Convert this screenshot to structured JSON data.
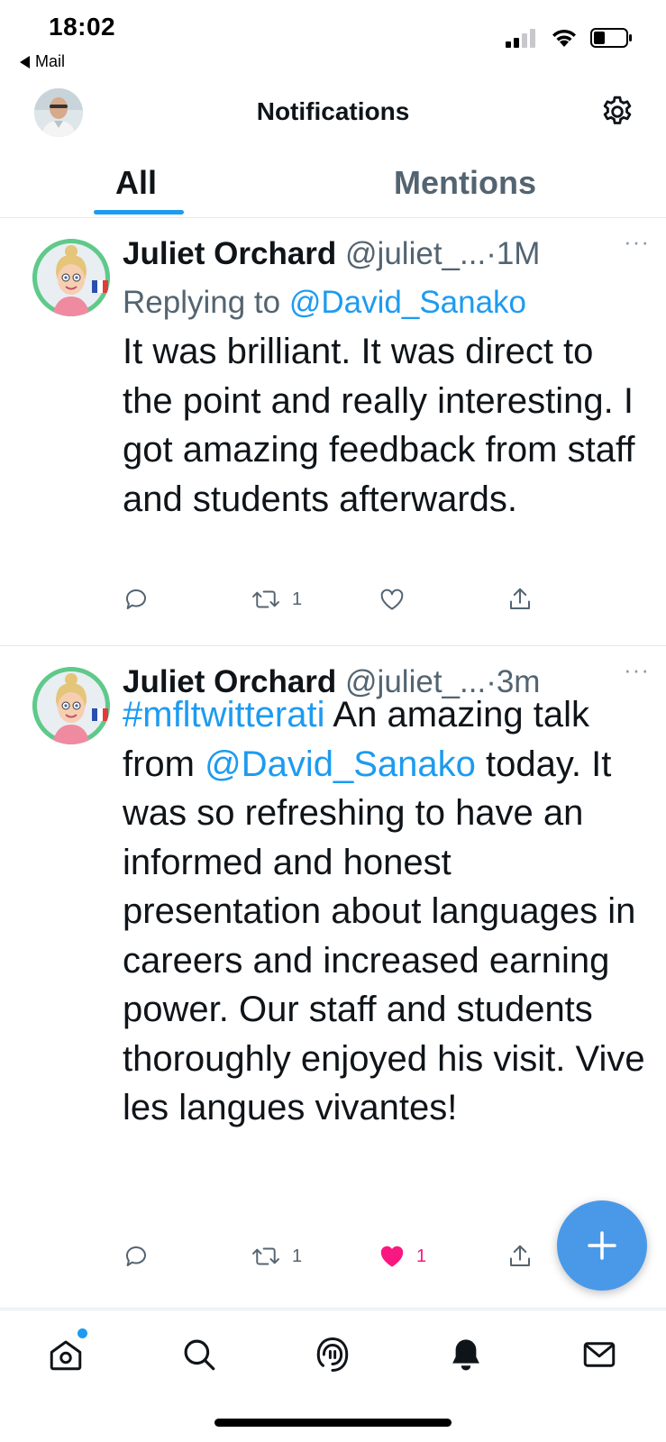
{
  "status_bar": {
    "time": "18:02",
    "back_app": "Mail",
    "icons": [
      "cellular-signal-icon",
      "wifi-icon",
      "battery-icon"
    ]
  },
  "header": {
    "title": "Notifications",
    "avatar_icon": "profile-avatar",
    "settings_icon": "gear-icon"
  },
  "tabs": [
    {
      "label": "All",
      "active": true
    },
    {
      "label": "Mentions",
      "active": false
    }
  ],
  "tweets": [
    {
      "author_name": "Juliet Orchard",
      "author_handle": "@juliet_...",
      "separator": "·",
      "time": "1M",
      "more_label": "···",
      "replying_prefix": "Replying to",
      "replying_to": "@David_Sanako",
      "body": "It was brilliant. It was direct to the point and really interesting. I got amazing feedback from staff and students afterwards.",
      "actions": {
        "replies": "",
        "retweets": "1",
        "likes": "",
        "liked": false
      }
    },
    {
      "author_name": "Juliet Orchard",
      "author_handle": "@juliet_...",
      "separator": "·",
      "time": "3m",
      "more_label": "···",
      "hashtag": "#mfltwitterati",
      "body_part1": " An amazing talk from ",
      "mention": "@David_Sanako",
      "body_part2": " today. It was so refreshing to have an informed and honest presentation about languages in careers and increased earning power. Our staff and students thoroughly enjoyed his visit. Vive les langues vivantes!",
      "actions": {
        "replies": "",
        "retweets": "1",
        "likes": "1",
        "liked": true
      }
    }
  ],
  "fab": {
    "icon": "plus-icon"
  },
  "bottom_nav": [
    "home-icon",
    "search-icon",
    "spaces-icon",
    "notifications-bell-icon",
    "messages-envelope-icon"
  ],
  "colors": {
    "accent": "#1d9bf0",
    "like": "#f91880",
    "fab": "#4a99e9",
    "secondary_text": "#536471"
  }
}
